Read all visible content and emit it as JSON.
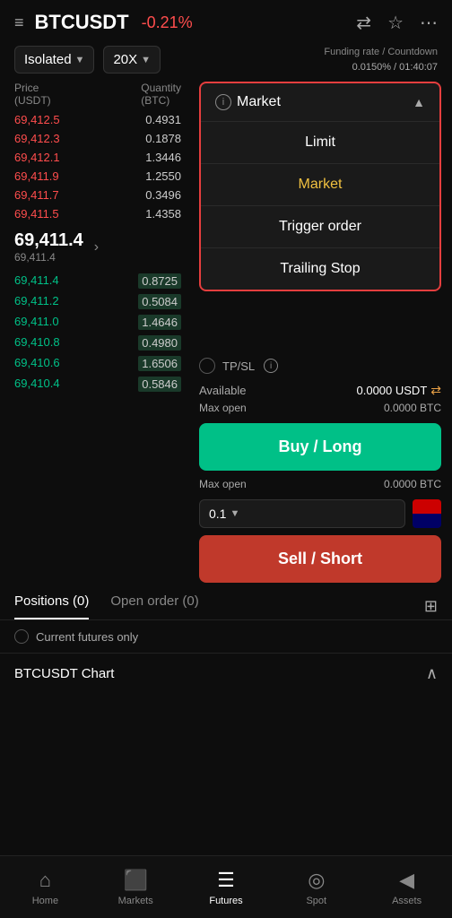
{
  "header": {
    "symbol": "BTCUSDT",
    "change": "-0.21%",
    "hamburger": "≡",
    "icons": [
      "⇄",
      "☆",
      "⋯"
    ]
  },
  "controls": {
    "margin_mode": "Isolated",
    "leverage": "20X",
    "funding_label": "Funding rate / Countdown",
    "funding_rate": "0.0150% / 01:40:07"
  },
  "order_book": {
    "col_price": "Price",
    "col_price_unit": "(USDT)",
    "col_qty": "Quantity",
    "col_qty_unit": "(BTC)",
    "asks": [
      {
        "price": "69,412.5",
        "qty": "0.4931"
      },
      {
        "price": "69,412.3",
        "qty": "0.1878"
      },
      {
        "price": "69,412.1",
        "qty": "1.3446"
      },
      {
        "price": "69,411.9",
        "qty": "1.2550"
      },
      {
        "price": "69,411.7",
        "qty": "0.3496"
      },
      {
        "price": "69,411.5",
        "qty": "1.4358"
      }
    ],
    "mid_price": "69,411.4",
    "mid_sub": "69,411.4",
    "bids": [
      {
        "price": "69,411.4",
        "qty": "0.8725"
      },
      {
        "price": "69,411.2",
        "qty": "0.5084"
      },
      {
        "price": "69,411.0",
        "qty": "1.4646"
      },
      {
        "price": "69,410.8",
        "qty": "0.4980"
      },
      {
        "price": "69,410.6",
        "qty": "1.6506"
      },
      {
        "price": "69,410.4",
        "qty": "0.5846"
      }
    ]
  },
  "order_type_dropdown": {
    "current": "Market",
    "info_icon": "i",
    "options": [
      {
        "label": "Limit",
        "style": "normal"
      },
      {
        "label": "Market",
        "style": "market-active"
      },
      {
        "label": "Trigger order",
        "style": "normal"
      },
      {
        "label": "Trailing Stop",
        "style": "normal"
      }
    ]
  },
  "panel": {
    "tpsl_label": "TP/SL",
    "available_label": "Available",
    "available_value": "0.0000 USDT",
    "max_open_label1": "Max open",
    "max_open_value1": "0.0000 BTC",
    "buy_label": "Buy / Long",
    "max_open_label2": "Max open",
    "max_open_value2": "0.0000 BTC",
    "sell_label": "Sell / Short",
    "qty_value": "0.1"
  },
  "tabs": {
    "positions_label": "Positions (0)",
    "open_order_label": "Open order  (0)",
    "futures_filter": "Current futures only"
  },
  "chart": {
    "title": "BTCUSDT Chart"
  },
  "bottom_nav": {
    "items": [
      {
        "label": "Home",
        "icon": "⌂"
      },
      {
        "label": "Markets",
        "icon": "⬛"
      },
      {
        "label": "Futures",
        "icon": "☰"
      },
      {
        "label": "Spot",
        "icon": "◎"
      },
      {
        "label": "Assets",
        "icon": "◀"
      }
    ],
    "active_index": 2
  }
}
